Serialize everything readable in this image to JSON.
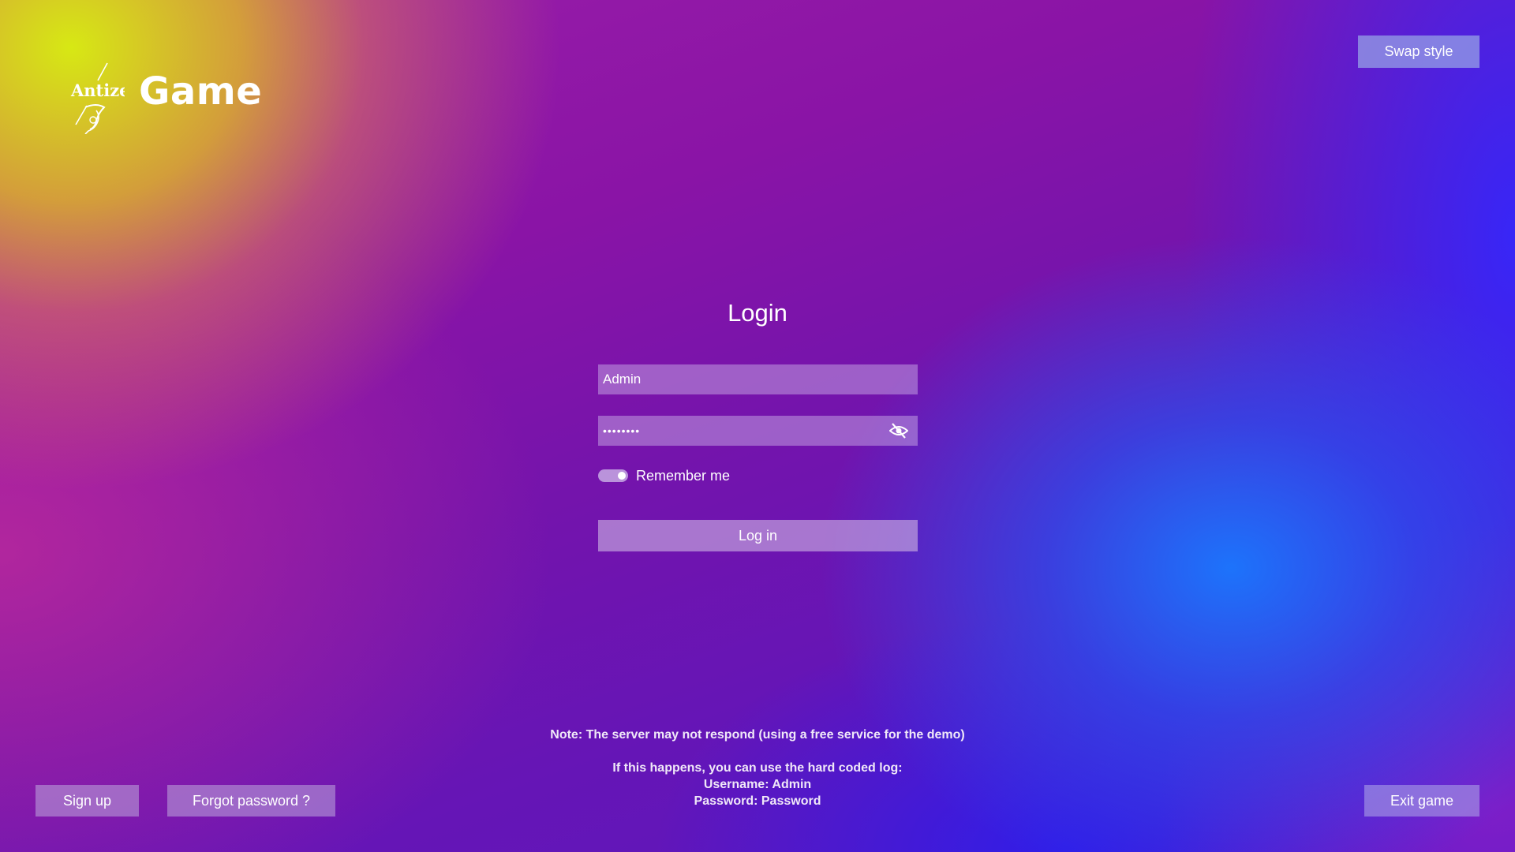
{
  "header": {
    "logo_text": "Antize",
    "game_title": "Game",
    "swap_style_label": "Swap style"
  },
  "login": {
    "title": "Login",
    "username_value": "Admin",
    "password_value": "Password",
    "password_visibility_icon": "eye-off-icon",
    "remember_label": "Remember me",
    "remember_checked": true,
    "login_button_label": "Log in"
  },
  "notes": {
    "server": "Note: The server may not respond (using a free service for the demo)",
    "hint": "If this happens, you can use the hard coded log:",
    "username": "Username: Admin",
    "password": "Password: Password"
  },
  "footer": {
    "signup_label": "Sign up",
    "forgot_label": "Forgot password ?",
    "exit_label": "Exit game"
  },
  "colors": {
    "text": "#ffffff",
    "button_bg": "#bea9dc",
    "field_bg": "#c8aae6"
  }
}
